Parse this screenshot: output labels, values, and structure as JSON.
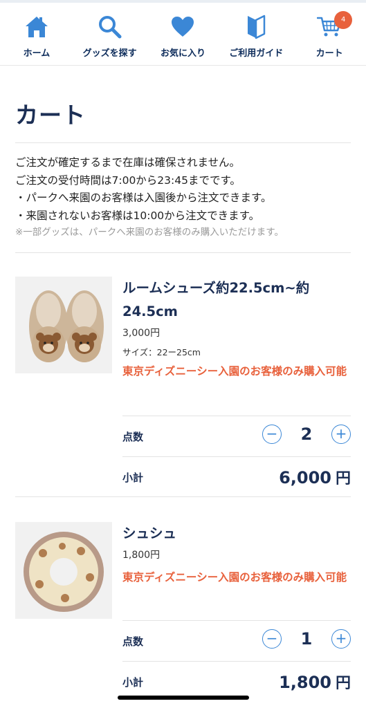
{
  "nav": {
    "items": [
      {
        "label": "ホーム",
        "icon": "home-icon"
      },
      {
        "label": "グッズを探す",
        "icon": "search-icon"
      },
      {
        "label": "お気に入り",
        "icon": "heart-icon"
      },
      {
        "label": "ご利用ガイド",
        "icon": "guide-icon"
      },
      {
        "label": "カート",
        "icon": "cart-icon"
      }
    ],
    "cart_count": "4",
    "accent": "#3b87d6"
  },
  "page": {
    "title": "カート"
  },
  "notice": {
    "lines": [
      "ご注文が確定するまで在庫は確保されません。",
      "ご注文の受付時間は7:00から23:45までです。",
      "・パークへ来園のお客様は入園後から注文できます。",
      "・来園されないお客様は10:00から注文できます。"
    ],
    "sub": "※一部グッズは、パークへ来園のお客様のみ購入いただけます。"
  },
  "items": [
    {
      "name": "ルームシューズ約22.5cm~約24.5cm",
      "price": "3,000円",
      "size": "サイズ：22ー25cm",
      "restriction": "東京ディズニーシー入園のお客様のみ購入可能",
      "qty_label": "点数",
      "qty": "2",
      "subtotal_label": "小計",
      "subtotal": "6,000",
      "unit": "円"
    },
    {
      "name": "シュシュ",
      "price": "1,800円",
      "size": "",
      "restriction": "東京ディズニーシー入園のお客様のみ購入可能",
      "qty_label": "点数",
      "qty": "1",
      "subtotal_label": "小計",
      "subtotal": "1,800",
      "unit": "円"
    }
  ],
  "colors": {
    "primary": "#1c2f55",
    "warning": "#e8613c",
    "badge": "#e8613c"
  }
}
